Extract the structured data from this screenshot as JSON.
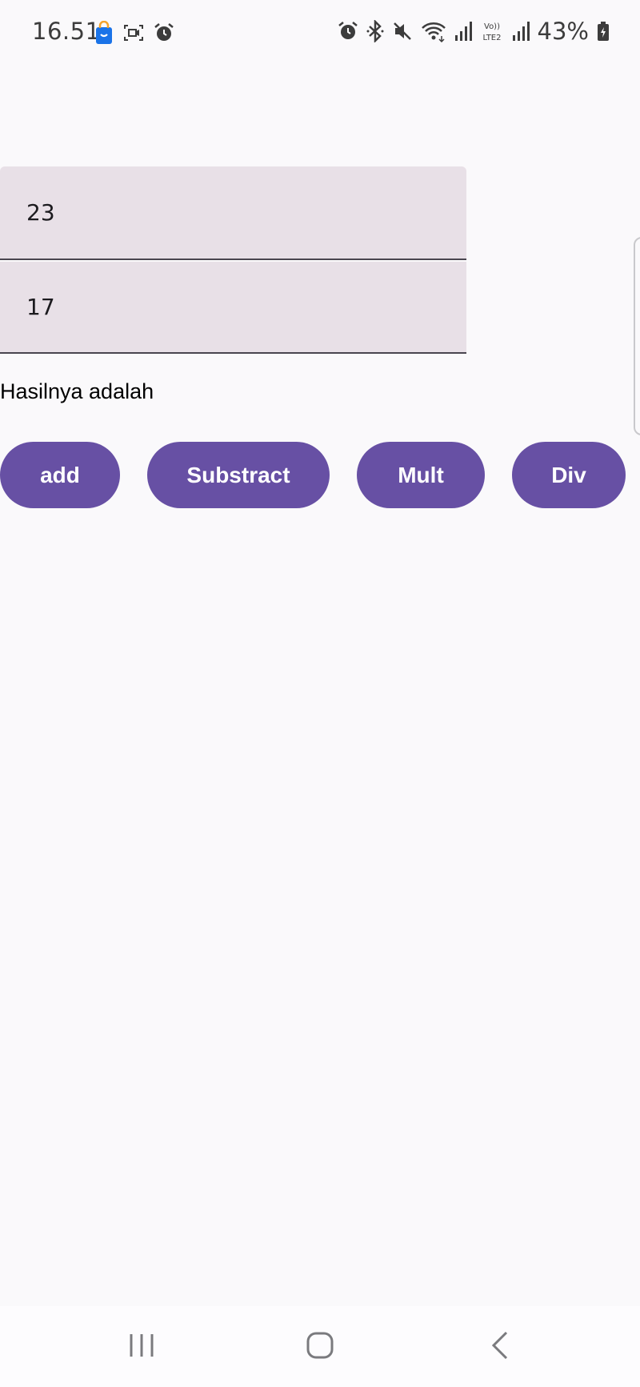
{
  "status_bar": {
    "time": "16.51",
    "battery_percent": "43%",
    "left_icons": [
      "shopping-bag-app-icon",
      "screen-record-icon",
      "alarm-icon"
    ],
    "right_icons": [
      "alarm-icon",
      "bluetooth-icon",
      "mute-icon",
      "wifi-icon",
      "signal-icon",
      "volte-lte2-icon",
      "signal-icon",
      "battery-icon"
    ]
  },
  "form": {
    "first_number": "23",
    "second_number": "17",
    "result_label": "Hasilnya adalah"
  },
  "buttons": {
    "add": "add",
    "substract": "Substract",
    "mult": "Mult",
    "div": "Div"
  },
  "nav_bar": {
    "icons": [
      "recents-icon",
      "home-icon",
      "back-icon"
    ]
  },
  "colors": {
    "primary": "#6750a4",
    "field_background": "#e8e0e7",
    "background": "#faf9fb"
  }
}
